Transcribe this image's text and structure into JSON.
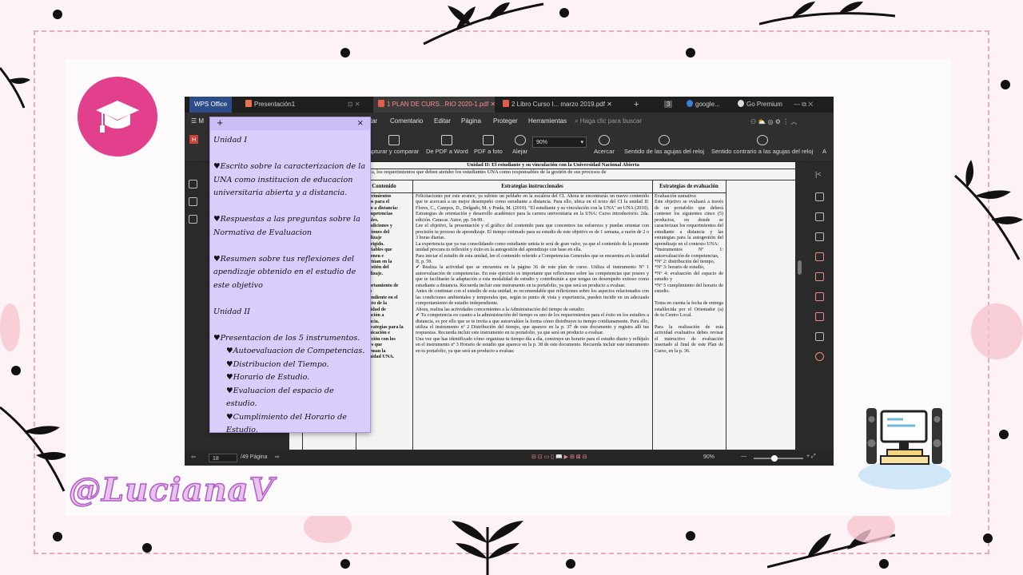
{
  "tabs": [
    {
      "label": "WPS Office"
    },
    {
      "label": "Presentación1"
    },
    {
      "label": "1 PLAN DE CURS...RIO 2020-1.pdf"
    },
    {
      "label": "2 Libro Curso I... marzo 2019.pdf"
    },
    {
      "label": "+"
    },
    {
      "label": "3"
    },
    {
      "label": "google..."
    },
    {
      "label": "Go Premium"
    }
  ],
  "menu": [
    "tar",
    "Comentario",
    "Editar",
    "Página",
    "Proteger",
    "Herramientas"
  ],
  "search_placeholder": "Haga clic para buscar",
  "toolbar": {
    "capture": "apturar y comparar",
    "pdf_to_word": "De PDF a Word",
    "pdf_to_photo": "PDF a foto",
    "zoom_out": "Alejar",
    "zoom_value": "90%",
    "zoom_in": "Acercar",
    "rotate_cw": "Sentido de las agujas del reloj",
    "rotate_ccw": "Sentido contrario a las agujas del reloj",
    "more": "A"
  },
  "status": {
    "page_input": "18",
    "page_total": "/49 Página",
    "zoom": "90%"
  },
  "document": {
    "unit_title": "Unidad II: El estudiante y su vinculación con la Universidad Nacional Abierta",
    "objective": "Caracterizar, de forma crítica, los requerimientos que deben atender los estudiantes UNA como responsables de la gestión de sus procesos de",
    "col_contenido": "Contenido",
    "col_estrategias": "Estrategias instruccionales",
    "col_evaluacion": "Estrategias de evaluación",
    "left_fragments": [
      "erimientos",
      "os para el",
      "io a distancia:",
      "mpetencias",
      "ales.",
      "ndiciones y",
      "ciones del",
      "dizaje",
      "irigido.",
      "riables que",
      "ienen e",
      "ctúan en la",
      "estión del",
      "dizaje.",
      "",
      "ortamiento de",
      "o",
      "endiente en el",
      "xto de la",
      "lidad de",
      "ación a",
      "ncia.",
      "trategias para la",
      "nicación e",
      "cción con los",
      "es que",
      "rman la",
      "nidad UNA."
    ],
    "middle_text": [
      "Felicitaciones por este avance, ya subiste un peldaño en la escalera del CI. Ahora te encontrarás un nuevo contenido que te acercará a un mejor desempeño como estudiante a distancia. Para ello, ubica en el texto del CI la unidad II: Flores, C., Campos, D., Delgado, M. y Prada, M. (2010). \"El estudiante y su vinculación con la UNA\" en UNA (2010). Estrategias de orientación y desarrollo académico para la carrera universitaria en la UNA: Curso introductorio. 2da. edición. Caracas. Autor, pp. 54-99.",
      "Lee el objetivo, la presentación y el gráfico del contenido para que concentres tus esfuerzos y puedas orientar con precisión tu proceso de aprendizaje. El tiempo estimado para su estudio de este objetivo es de 1 semana, a razón de 2 o 3 horas diarias.",
      "La experiencia que ya vas consolidando como estudiante unista te será de gran valor, ya que el contenido de la presente unidad procura tu reflexión y éxito en la autogestión del aprendizaje con base en ella.",
      "Para iniciar el estudio de esta unidad, lee el contenido referido a Competencias Generales que se encuentra en la unidad II, p. 59.",
      "✔ Realiza la actividad que se encuentra en la página 36 de este plan de curso. Utiliza el instrumento Nº 1 autoevaluación de competencias. En este ejercicio es importante que reflexiones sobre las competencias que posees y que te facilitarán la adaptación a esta modalidad de estudio y contribuirán a que tengas un desempeño exitoso como estudiante a distancia. Recuerda incluir este instrumento en tu portafolio, ya que será un producto a evaluar.",
      "Antes de continuar con el estudio de esta unidad, es recomendable que reflexiones sobre los aspectos relacionados con las condiciones ambientales y temporales que, según tu punto de vista y experiencia, pueden incidir en un adecuado comportamiento de estudio independiente.",
      "Ahora, realiza las actividades concernientes a la Administración del tiempo de estudio:",
      "✔ Tu competencia en cuanto a la administración del tiempo es uno de los requerimientos para el éxito en los estudios a distancia, es por ello que se te invita a que autoevalúes la forma cómo distribuyes tu tiempo cotidianamente. Para ello, utiliza el instrumento nº 2 Distribución del tiempo, que aparece en la p. 37 de este documento y registra allí tus respuestas. Recuerda incluir este instrumento en tu portafolio, ya que será un producto a evaluar.",
      "Una vez que has identificado cómo organizas tu tiempo día a día, construye un horario para el estudio diario y refléjalo en el instrumento nº 3 Horario de estudio que aparece en la p. 38 de este documento. Recuerda incluir este instrumento en tu portafolio, ya que será un producto a evaluar."
    ],
    "right_text": [
      "Evaluación sumativa:",
      "Este objetivo se evaluará a través de un portafolio que deberá contener los siguientes cinco (5) productos, en donde se caracterizan los requerimientos del estudiante a distancia y las estrategias para la autogestión del aprendizaje en el contexto UNA:",
      "*Instrumentos Nº 1: autoevaluación de competencias,",
      "*Nº 2: distribución del tiempo,",
      "*Nº 3: horario de estudio,",
      "*Nº 4: evaluación del espacio de estudio y",
      "*Nº 5 cumplimiento del horario de estudio.",
      "",
      "Toma en cuenta la fecha de entrega establecida por el Orientador (a) de tu Centro Local.",
      "",
      "Para la realización de esta actividad evaluativa debes revisar el instructivo de evaluación insertado al final de este Plan de Curso, en la p. 36."
    ]
  },
  "note": {
    "lines": [
      {
        "text": "Unidad I",
        "indent": false
      },
      {
        "text": "",
        "indent": false
      },
      {
        "text": "♥Escrito sobre la caracterizacion de la UNA como institucion de educacion universitaria abierta y a distancia.",
        "indent": false
      },
      {
        "text": "",
        "indent": false
      },
      {
        "text": "♥Respuestas a las preguntas sobre la Normativa de Evaluacion",
        "indent": false
      },
      {
        "text": "",
        "indent": false
      },
      {
        "text": "♥Resumen sobre tus reflexiones del apendizaje obtenido en el estudio de este objetivo",
        "indent": false
      },
      {
        "text": "",
        "indent": false
      },
      {
        "text": "Unidad II",
        "indent": false
      },
      {
        "text": "",
        "indent": false
      },
      {
        "text": "♥Presentacion de los 5 instrumentos.",
        "indent": false
      },
      {
        "text": "♥Autoevaluacion de Competencias.",
        "indent": true
      },
      {
        "text": "♥Distribucion del Tiempo.",
        "indent": true
      },
      {
        "text": "♥Horario de Estudio.",
        "indent": true
      },
      {
        "text": "♥Evaluacion del espacio de estudio.",
        "indent": true
      },
      {
        "text": "♥Cumplimiento del Horario de Estudio.",
        "indent": true
      }
    ],
    "add": "+",
    "close": "×"
  },
  "signature": "@LucianaV",
  "colors": {
    "accent_pink": "#e23f8c",
    "note_bg": "#d9cdfb",
    "frame_dash": "#e9a9c0"
  }
}
